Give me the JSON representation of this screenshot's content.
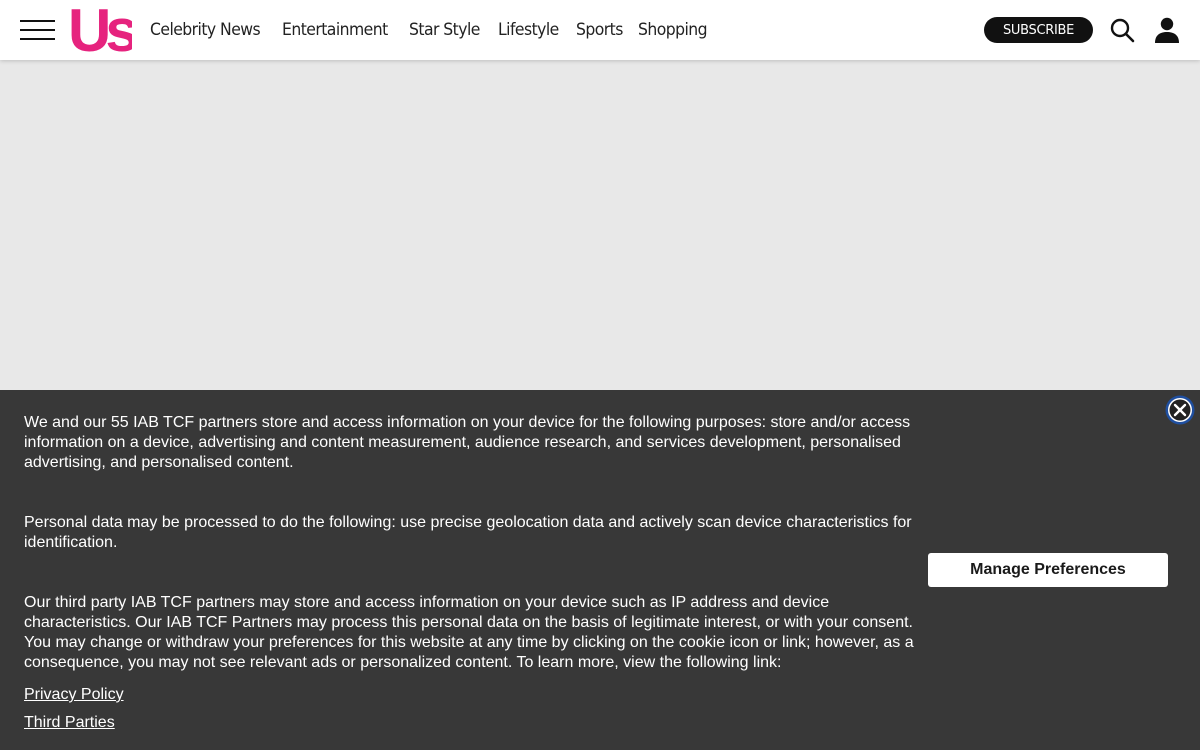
{
  "header": {
    "logo_text": "Us",
    "nav": [
      {
        "label": "Celebrity News"
      },
      {
        "label": "Entertainment"
      },
      {
        "label": "Star Style"
      },
      {
        "label": "Lifestyle"
      },
      {
        "label": "Sports"
      },
      {
        "label": "Shopping"
      }
    ],
    "subscribe_label": "SUBSCRIBE",
    "search_icon": "search-icon",
    "account_icon": "user-icon",
    "menu_icon": "hamburger-menu-icon"
  },
  "colors": {
    "brand_pink": "#e6237e",
    "header_bg": "#ffffff",
    "content_bg": "#e8e8e8",
    "consent_bg": "#383838",
    "close_ring": "#1f4fa0"
  },
  "consent": {
    "paragraph_1": "We and our 55 IAB TCF partners store and access information on your device for the following purposes: store and/or access information on a device, advertising and content measurement, audience research, and services development, personalised advertising, and personalised content.",
    "paragraph_2": "Personal data may be processed to do the following: use precise geolocation data and actively scan device characteristics for identification.",
    "paragraph_3": "Our third party IAB TCF partners may store and access information on your device such as IP address and device characteristics. Our IAB TCF Partners may process this personal data on the basis of legitimate interest, or with your consent. You may change or withdraw your preferences for this website at any time by clicking on the cookie icon or link; however, as a consequence, you may not see relevant ads or personalized content. To learn more, view the following link:",
    "privacy_link": "Privacy Policy",
    "third_parties_link": "Third Parties",
    "manage_label": "Manage Preferences",
    "close_icon": "close-icon"
  }
}
